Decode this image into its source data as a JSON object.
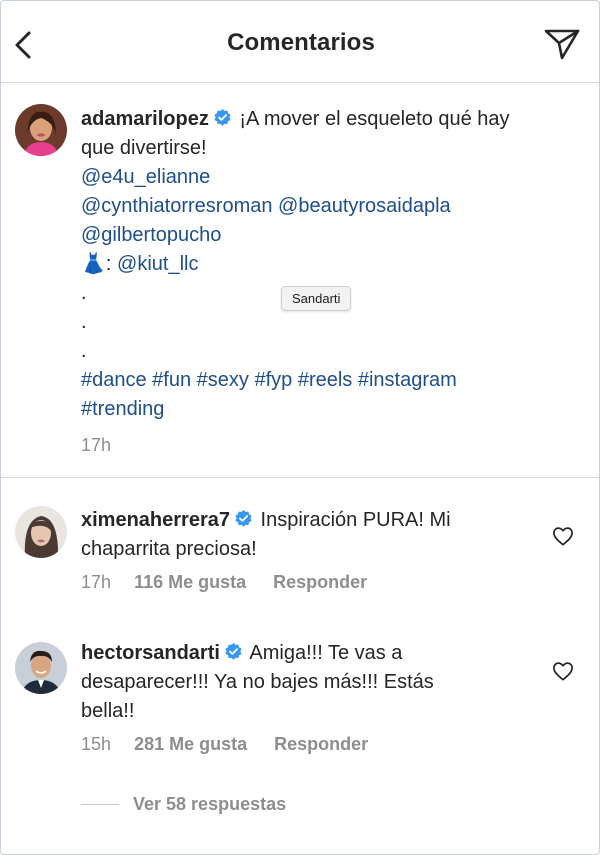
{
  "header": {
    "title": "Comentarios",
    "back_icon": "chevron-left-icon",
    "send_icon": "paper-plane-icon"
  },
  "caption": {
    "username": "adamarilopez",
    "verified": true,
    "text_line1": "¡A mover el esqueleto qué hay",
    "text_line2": "que divertirse!",
    "mention_1": "@e4u_elianne",
    "mention_2": "@cynthiatorresroman",
    "mention_3": "@beautyrosaidapla",
    "mention_4": "@gilbertopucho",
    "dress_emoji": "👗",
    "dress_sep": ": ",
    "mention_5": "@kiut_llc",
    "dot": ".",
    "hashtags_line1": "#dance #fun #sexy #fyp #reels #instagram",
    "hashtags_line2": "#trending",
    "time": "17h"
  },
  "tooltip": {
    "text": "Sandarti"
  },
  "comments": [
    {
      "username": "ximenaherrera7",
      "verified": true,
      "text_line1": "Inspiración PURA! Mi",
      "text_line2": "chaparrita preciosa!",
      "time": "17h",
      "likes": "116 Me gusta",
      "reply": "Responder"
    },
    {
      "username": "hectorsandarti",
      "verified": true,
      "text_line1": "Amiga!!! Te vas a",
      "text_line2": "desaparecer!!! Ya no bajes más!!! Estás",
      "text_line3": "bella!!",
      "time": "15h",
      "likes": "281 Me gusta",
      "reply": "Responder",
      "view_replies": "Ver 58 respuestas"
    }
  ],
  "colors": {
    "text": "#262626",
    "secondary": "#8e8e8e",
    "link": "#1e4f8c",
    "verified": "#3897f0",
    "divider": "#dbdbdb"
  }
}
